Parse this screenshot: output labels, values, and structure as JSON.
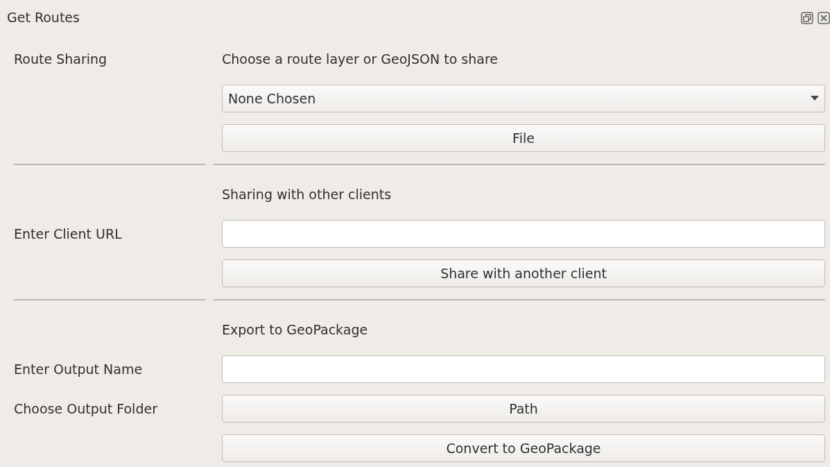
{
  "window": {
    "title": "Get Routes"
  },
  "sections": [
    {
      "rows": [
        {
          "kind": "heading",
          "label": "Route Sharing",
          "text": "Choose a route layer or GeoJSON to share"
        },
        {
          "kind": "dropdown",
          "value": "None Chosen"
        },
        {
          "kind": "button",
          "text": "File"
        }
      ]
    },
    {
      "rows": [
        {
          "kind": "heading",
          "text": "Sharing with other clients"
        },
        {
          "kind": "input",
          "label": "Enter Client URL"
        },
        {
          "kind": "button",
          "text": "Share with another client"
        }
      ]
    },
    {
      "rows": [
        {
          "kind": "heading",
          "text": "Export to GeoPackage"
        },
        {
          "kind": "input",
          "label": "Enter Output Name"
        },
        {
          "kind": "button",
          "label": "Choose Output Folder",
          "text": "Path"
        },
        {
          "kind": "button",
          "text": "Convert to GeoPackage"
        }
      ]
    }
  ]
}
